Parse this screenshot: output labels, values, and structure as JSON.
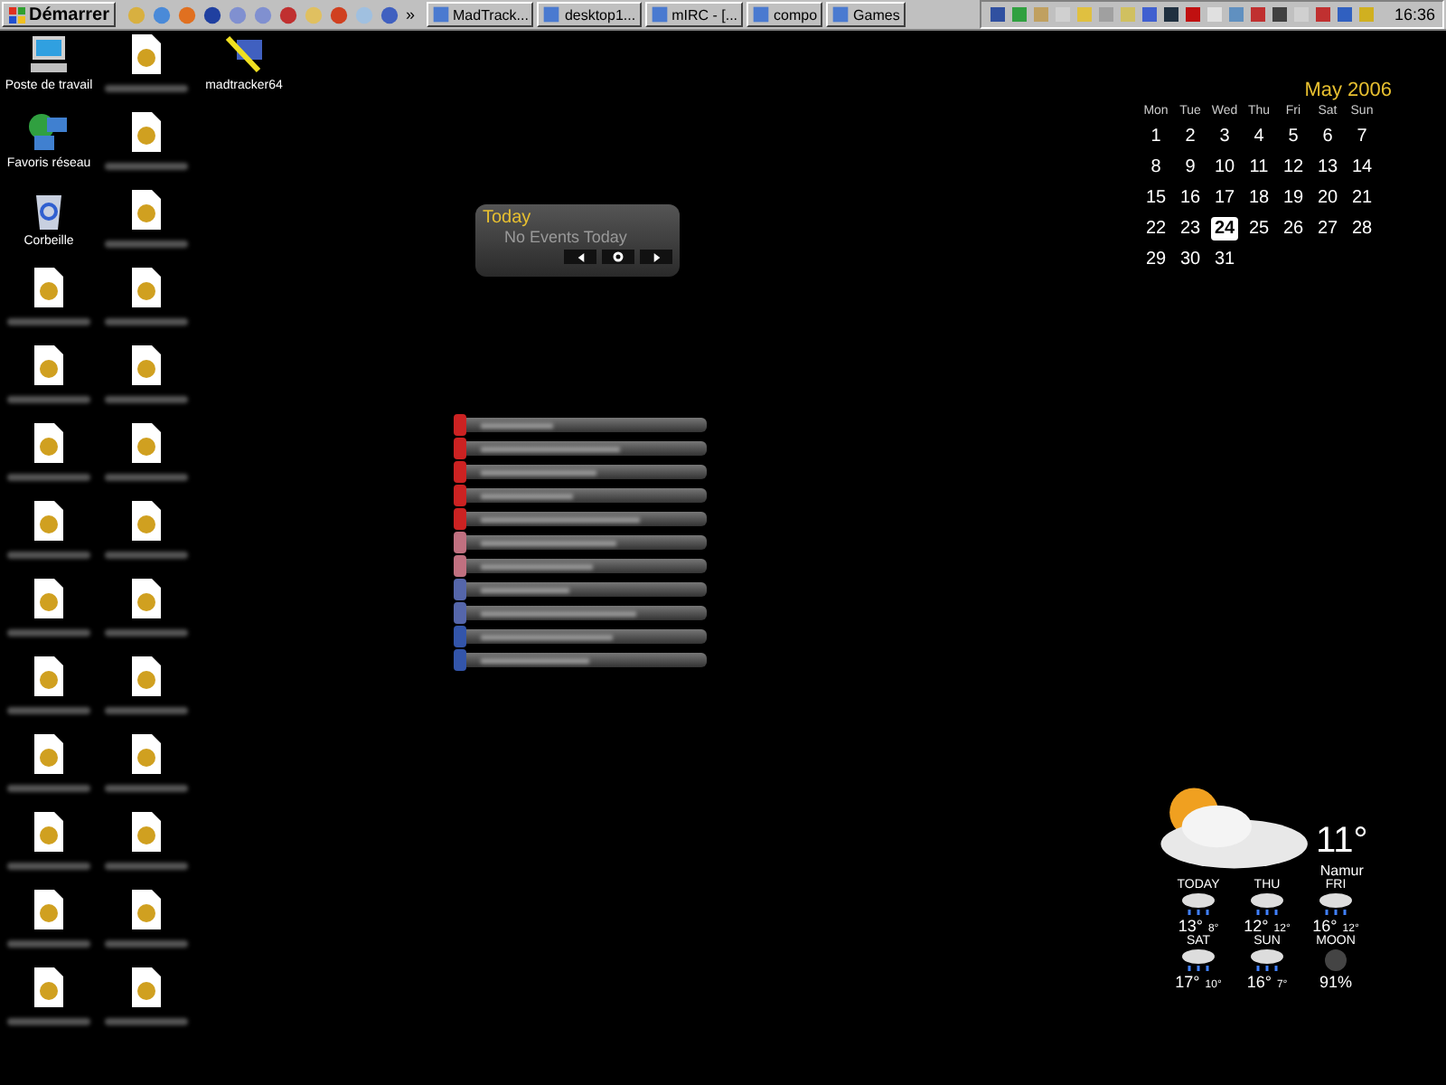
{
  "taskbar": {
    "start_button": "Démarrer",
    "quick_launch_count_label": "»",
    "tasks": [
      {
        "label": "MadTrack...",
        "selected": false
      },
      {
        "label": "desktop1...",
        "selected": false
      },
      {
        "label": "mIRC - [...",
        "selected": false
      },
      {
        "label": "compo",
        "selected": false
      },
      {
        "label": "Games",
        "selected": false
      }
    ],
    "clock": "16:36"
  },
  "desktop_icons": [
    {
      "label": "Poste de travail",
      "kind": "computer"
    },
    {
      "label": "Favoris réseau",
      "kind": "network"
    },
    {
      "label": "Corbeille",
      "kind": "recycle"
    },
    {
      "label": "madtracker64",
      "kind": "tool"
    }
  ],
  "calendar": {
    "title": "May 2006",
    "weekdays": [
      "Mon",
      "Tue",
      "Wed",
      "Thu",
      "Fri",
      "Sat",
      "Sun"
    ],
    "weeks": [
      [
        {
          "day": "1",
          "selected": false
        },
        {
          "day": "2",
          "selected": false
        },
        {
          "day": "3",
          "selected": false
        },
        {
          "day": "4",
          "selected": false
        },
        {
          "day": "5",
          "selected": false
        },
        {
          "day": "6",
          "selected": false
        },
        {
          "day": "7",
          "selected": false
        }
      ],
      [
        {
          "day": "8",
          "selected": false
        },
        {
          "day": "9",
          "selected": false
        },
        {
          "day": "10",
          "selected": false
        },
        {
          "day": "11",
          "selected": false
        },
        {
          "day": "12",
          "selected": false
        },
        {
          "day": "13",
          "selected": false
        },
        {
          "day": "14",
          "selected": false
        }
      ],
      [
        {
          "day": "15",
          "selected": false
        },
        {
          "day": "16",
          "selected": false
        },
        {
          "day": "17",
          "selected": false
        },
        {
          "day": "18",
          "selected": false
        },
        {
          "day": "19",
          "selected": false
        },
        {
          "day": "20",
          "selected": false
        },
        {
          "day": "21",
          "selected": false
        }
      ],
      [
        {
          "day": "22",
          "selected": false
        },
        {
          "day": "23",
          "selected": false
        },
        {
          "day": "24",
          "selected": true
        },
        {
          "day": "25",
          "selected": false
        },
        {
          "day": "26",
          "selected": false
        },
        {
          "day": "27",
          "selected": false
        },
        {
          "day": "28",
          "selected": false
        }
      ],
      [
        {
          "day": "29",
          "selected": false
        },
        {
          "day": "30",
          "selected": false
        },
        {
          "day": "31",
          "selected": false
        }
      ]
    ]
  },
  "today_widget": {
    "title": "Today",
    "message": "No Events Today"
  },
  "task_list": [
    {
      "color": "#cc2222"
    },
    {
      "color": "#cc2222"
    },
    {
      "color": "#cc2222"
    },
    {
      "color": "#cc2222"
    },
    {
      "color": "#cc2222"
    },
    {
      "color": "#c07080"
    },
    {
      "color": "#c07080"
    },
    {
      "color": "#5566aa"
    },
    {
      "color": "#5566aa"
    },
    {
      "color": "#3355aa"
    },
    {
      "color": "#3355aa"
    }
  ],
  "weather": {
    "temperature": "11°",
    "location": "Namur",
    "forecast": [
      {
        "day": "TODAY",
        "high": "13°",
        "low": "8°",
        "kind": "rain"
      },
      {
        "day": "THU",
        "high": "12°",
        "low": "12°",
        "kind": "rain"
      },
      {
        "day": "FRI",
        "high": "16°",
        "low": "12°",
        "kind": "rain"
      },
      {
        "day": "SAT",
        "high": "17°",
        "low": "10°",
        "kind": "rain"
      },
      {
        "day": "SUN",
        "high": "16°",
        "low": "7°",
        "kind": "rain"
      },
      {
        "day": "MOON",
        "high": "91%",
        "kind": "moon"
      }
    ]
  }
}
